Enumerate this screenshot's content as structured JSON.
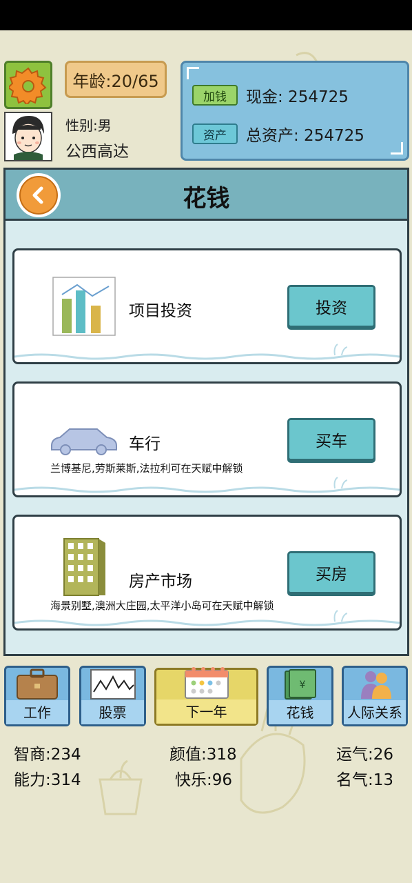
{
  "header": {
    "age_text": "年龄:20/65",
    "gender_text": "性别:男",
    "player_name": "公西高达"
  },
  "money": {
    "add_money_label": "加钱",
    "cash_text": "现金: 254725",
    "assets_label": "资产",
    "total_assets_text": "总资产: 254725"
  },
  "panel": {
    "title": "花钱"
  },
  "cards": [
    {
      "title": "项目投资",
      "note": "",
      "button": "投资",
      "icon": "bar-chart-icon"
    },
    {
      "title": "车行",
      "note": "兰博基尼,劳斯莱斯,法拉利可在天赋中解锁",
      "button": "买车",
      "icon": "car-icon"
    },
    {
      "title": "房产市场",
      "note": "海景别墅,澳洲大庄园,太平洋小岛可在天赋中解锁",
      "button": "买房",
      "icon": "building-icon"
    }
  ],
  "nav": {
    "work": "工作",
    "stocks": "股票",
    "next_year": "下一年",
    "spend": "花钱",
    "relations": "人际关系"
  },
  "stats": {
    "iq": "智商:234",
    "looks": "颜值:318",
    "luck": "运气:26",
    "ability": "能力:314",
    "happiness": "快乐:96",
    "fame": "名气:13"
  },
  "colors": {
    "background": "#e8e6cf",
    "panel_header": "#78b2bd",
    "action_button": "#6bc6cd",
    "money_panel": "#86c1de"
  }
}
